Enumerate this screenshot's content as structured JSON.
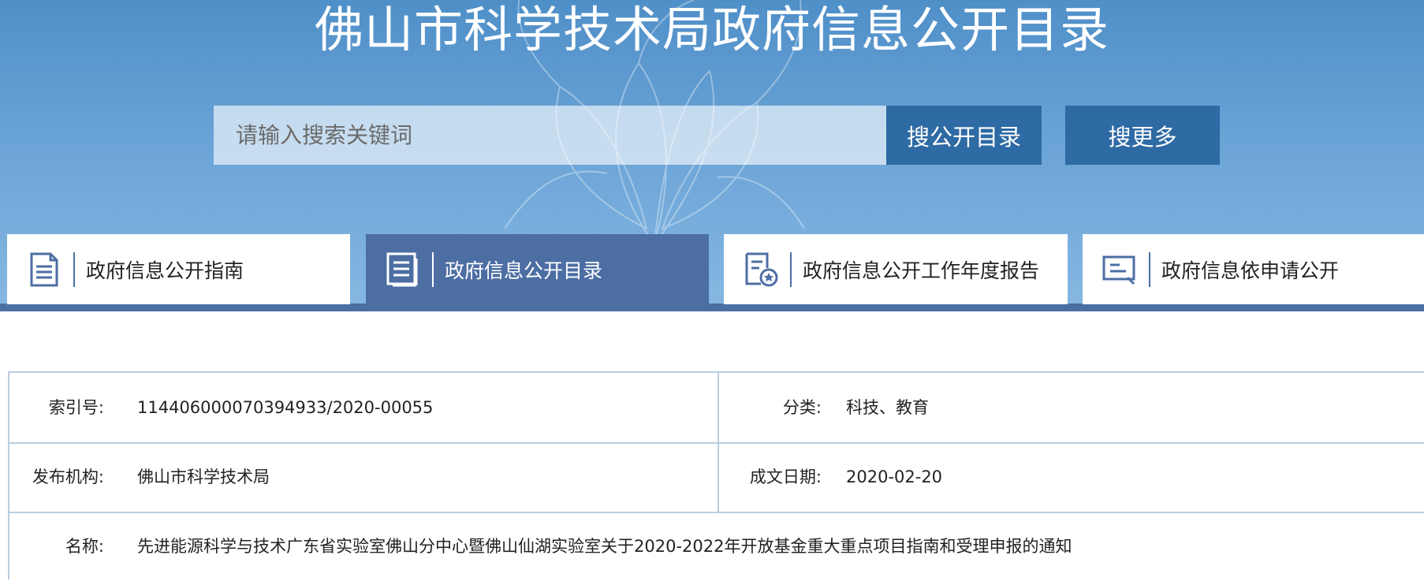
{
  "header": {
    "title": "佛山市科学技术局政府信息公开目录",
    "search_placeholder": "请输入搜索关键词",
    "btn_catalog": "搜公开目录",
    "btn_more": "搜更多"
  },
  "nav": [
    {
      "label": "政府信息公开指南",
      "icon": "document-list-icon",
      "active": false
    },
    {
      "label": "政府信息公开目录",
      "icon": "catalog-icon",
      "active": true
    },
    {
      "label": "政府信息公开工作年度报告",
      "icon": "report-star-icon",
      "active": false
    },
    {
      "label": "政府信息依申请公开",
      "icon": "application-form-icon",
      "active": false
    }
  ],
  "meta": {
    "index_label": "索引号:",
    "index_value": "114406000070394933/2020-00055",
    "category_label": "分类:",
    "category_value": "科技、教育",
    "publisher_label": "发布机构:",
    "publisher_value": "佛山市科学技术局",
    "date_label": "成文日期:",
    "date_value": "2020-02-20",
    "name_label": "名称:",
    "name_value": "先进能源科学与技术广东省实验室佛山分中心暨佛山仙湖实验室关于2020-2022年开放基金重大重点项目指南和受理申报的通知"
  },
  "colors": {
    "banner_top": "#4f8fc8",
    "banner_bottom": "#86b8e2",
    "button": "#2e6aa3",
    "active_nav": "#4c6ea3",
    "table_border": "#b9cde0"
  }
}
